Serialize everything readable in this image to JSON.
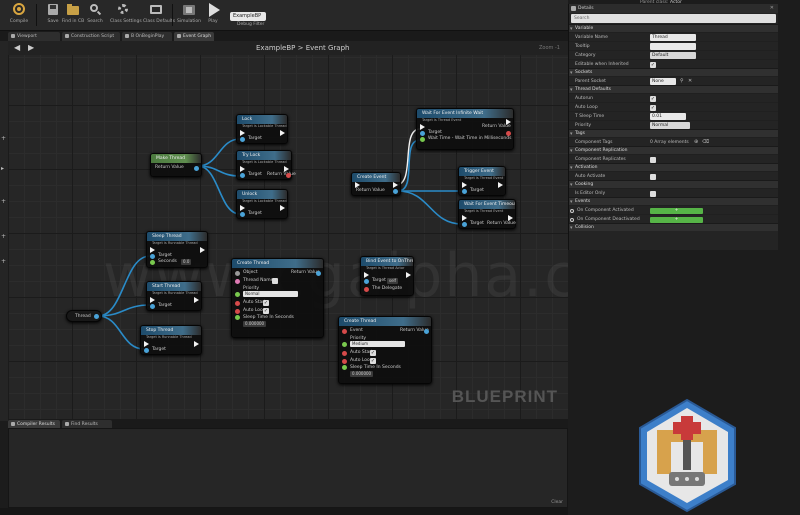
{
  "toolbar": {
    "buttons": [
      {
        "label": "Compile",
        "icon": "compile-icon"
      },
      {
        "label": "Save",
        "icon": "save-icon"
      },
      {
        "label": "Find in CB",
        "icon": "find-in-cb-icon"
      },
      {
        "label": "Search",
        "icon": "search-icon"
      },
      {
        "label": "Class Settings",
        "icon": "gear-icon"
      },
      {
        "label": "Class Defaults",
        "icon": "class-defaults-icon"
      },
      {
        "label": "Simulation",
        "icon": "simulation-icon"
      },
      {
        "label": "Play",
        "icon": "play-icon"
      }
    ],
    "debug_filter_value": "ExampleBP",
    "debug_filter_label": "Debug Filter"
  },
  "top_right": {
    "parent_class_label": "Parent class:",
    "parent_class_value": "Actor"
  },
  "tabs": [
    "Viewport",
    "Construction Script",
    "B OnBeginPlay",
    "Event Graph"
  ],
  "graph": {
    "breadcrumb": "ExampleBP > Event Graph",
    "zoom": "Zoom -1",
    "watermark": "BLUEPRINT",
    "site_watermark": "www.cgalpha.com",
    "back_icon": "back-arrow-icon",
    "forward_icon": "forward-arrow-icon"
  },
  "nodes": {
    "make_thread": {
      "title": "Make Thread",
      "out": "Return Value"
    },
    "lock": {
      "title": "Lock",
      "sub": "Target is Lockable Thread",
      "target": "Target"
    },
    "try_lock": {
      "title": "Try Lock",
      "sub": "Target is Lockable Thread",
      "target": "Target",
      "out": "Return Value"
    },
    "unlock": {
      "title": "Unlock",
      "sub": "Target is Lockable Thread",
      "target": "Target"
    },
    "create_event": {
      "title": "Create Event",
      "out": "Return Value"
    },
    "wait_for_event": {
      "title": "Wait For Event Infinite Wait",
      "sub": "Target is Thread Event",
      "target": "Target",
      "out": "Return Value",
      "wait_time": "Wait Time - Wait Time in Milliseconds"
    },
    "trigger_event": {
      "title": "Trigger Event",
      "sub": "Target is Thread Event",
      "target": "Target"
    },
    "wait_for_event_timeout": {
      "title": "Wait For Event Timeout",
      "sub": "Target is Thread Event",
      "target": "Target",
      "out": "Return Value"
    },
    "sleep_thread": {
      "title": "Sleep Thread",
      "sub": "Target is Runnable Thread",
      "target": "Target",
      "seconds": "Seconds",
      "seconds_val": "0.0"
    },
    "start_thread": {
      "title": "Start Thread",
      "sub": "Target is Runnable Thread",
      "target": "Target"
    },
    "stop_thread": {
      "title": "Stop Thread",
      "sub": "Target is Runnable Thread",
      "target": "Target"
    },
    "thread_var": {
      "title": "Thread"
    },
    "create_thread_left": {
      "title": "Create Thread",
      "object": "Object",
      "out": "Return Value",
      "thread_name": "Thread Name",
      "priority": "Priority",
      "priority_val": "Normal",
      "auto_start": "Auto Start",
      "auto_loop": "Auto Loop",
      "sleep_time": "Sleep Time In Seconds",
      "sleep_val": "0.000000"
    },
    "bind_event": {
      "title": "Bind Event to OnThread",
      "sub": "Target is Thread Actor",
      "target": "Target",
      "target_val": "self",
      "delegate": "The Delegate"
    },
    "create_thread_right": {
      "title": "Create Thread",
      "event": "Event",
      "out": "Return Value",
      "priority": "Priority",
      "priority_val": "Medium",
      "auto_start": "Auto Start",
      "auto_loop": "Auto Loop",
      "sleep_time": "Sleep Time In Seconds",
      "sleep_val": "0.000000"
    }
  },
  "bottom": {
    "tabs": [
      "Compiler Results",
      "Find Results"
    ],
    "clear": "Clear"
  },
  "details": {
    "title": "Details",
    "search_placeholder": "Search",
    "sections": {
      "variable": "Variable",
      "sockets": "Sockets",
      "thread_defaults": "Thread Defaults",
      "tags": "Tags",
      "component_replication": "Component Replication",
      "activation": "Activation",
      "cooking": "Cooking",
      "events": "Events",
      "collision": "Collision"
    },
    "props": {
      "variable_name": {
        "label": "Variable Name",
        "value": "Thread"
      },
      "tooltip": {
        "label": "Tooltip",
        "value": ""
      },
      "category": {
        "label": "Category",
        "value": "Default"
      },
      "editable": {
        "label": "Editable when Inherited"
      },
      "parent_socket": {
        "label": "Parent Socket",
        "value": "None"
      },
      "autorun": {
        "label": "Autorun"
      },
      "auto_loop": {
        "label": "Auto Loop"
      },
      "sleep_time": {
        "label": "T Sleep Time",
        "value": "0.01"
      },
      "priority": {
        "label": "Priority",
        "value": "Normal"
      },
      "component_tags": {
        "label": "Component Tags",
        "value": "0 Array elements"
      },
      "replicates": {
        "label": "Component Replicates"
      },
      "auto_activate": {
        "label": "Auto Activate"
      },
      "editor_only": {
        "label": "Is Editor Only"
      },
      "on_activated": {
        "label": "On Component Activated",
        "value": "+"
      },
      "on_deactivated": {
        "label": "On Component Deactivated",
        "value": "+"
      }
    }
  },
  "colors": {
    "exec_wire": "#f2f2f2",
    "object_wire": "#2a8bc8",
    "accent_green": "#56b447",
    "logo_blue": "#3d7fc9"
  }
}
